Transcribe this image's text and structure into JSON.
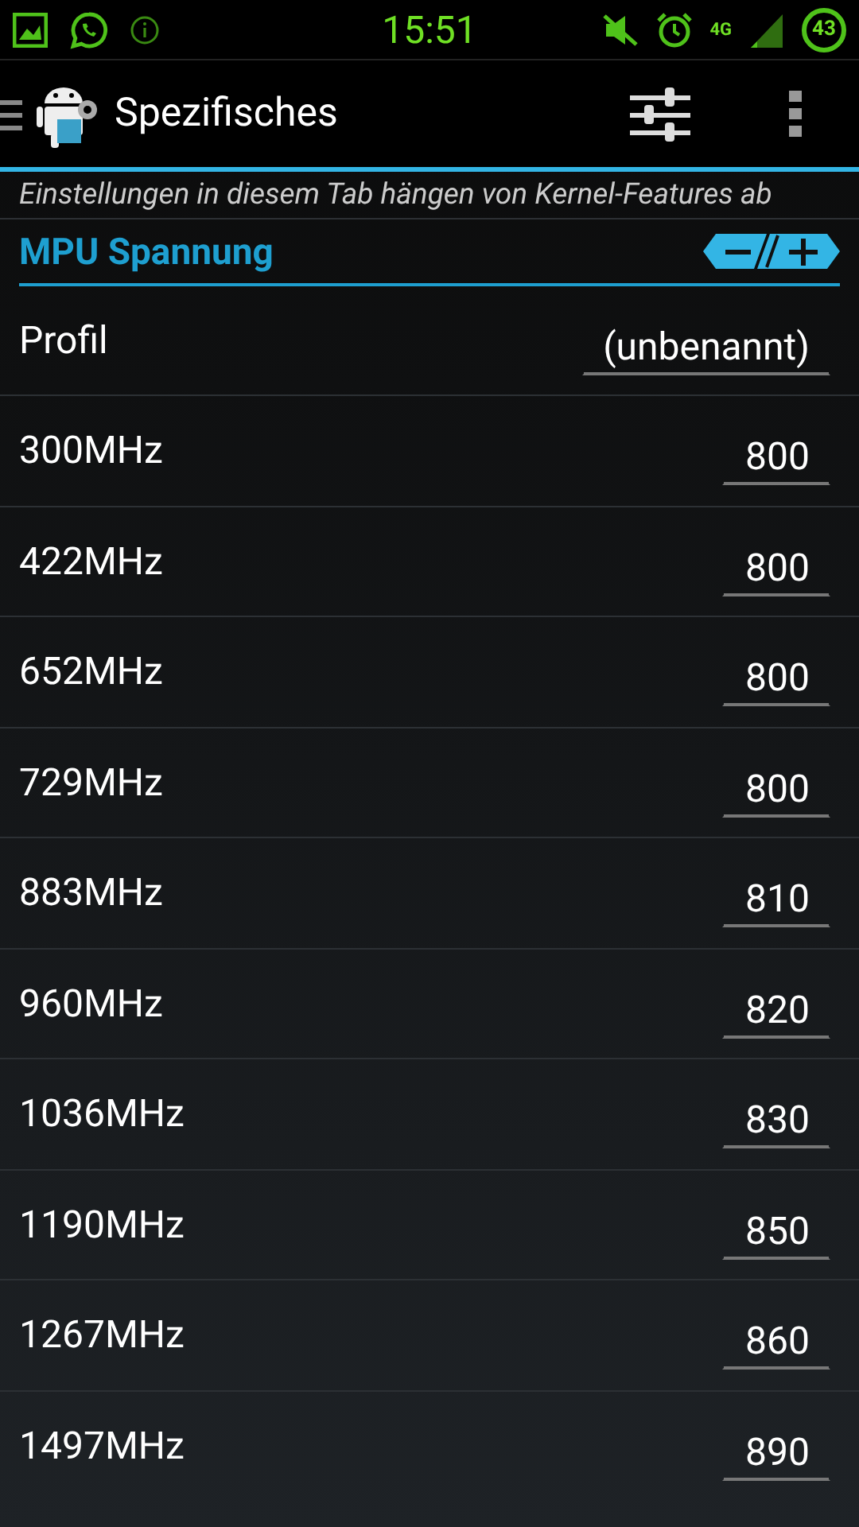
{
  "status_bar": {
    "time": "15:51",
    "network": "4G",
    "battery": "43"
  },
  "action_bar": {
    "title": "Spezifisches"
  },
  "note": "Einstellungen in diesem Tab hängen von Kernel-Features ab",
  "section": {
    "title": "MPU Spannung"
  },
  "profile": {
    "label": "Profil",
    "value": "(unbenannt)"
  },
  "rows": [
    {
      "label": "300MHz",
      "value": "800"
    },
    {
      "label": "422MHz",
      "value": "800"
    },
    {
      "label": "652MHz",
      "value": "800"
    },
    {
      "label": "729MHz",
      "value": "800"
    },
    {
      "label": "883MHz",
      "value": "810"
    },
    {
      "label": "960MHz",
      "value": "820"
    },
    {
      "label": "1036MHz",
      "value": "830"
    },
    {
      "label": "1190MHz",
      "value": "850"
    },
    {
      "label": "1267MHz",
      "value": "860"
    },
    {
      "label": "1497MHz",
      "value": "890"
    }
  ]
}
